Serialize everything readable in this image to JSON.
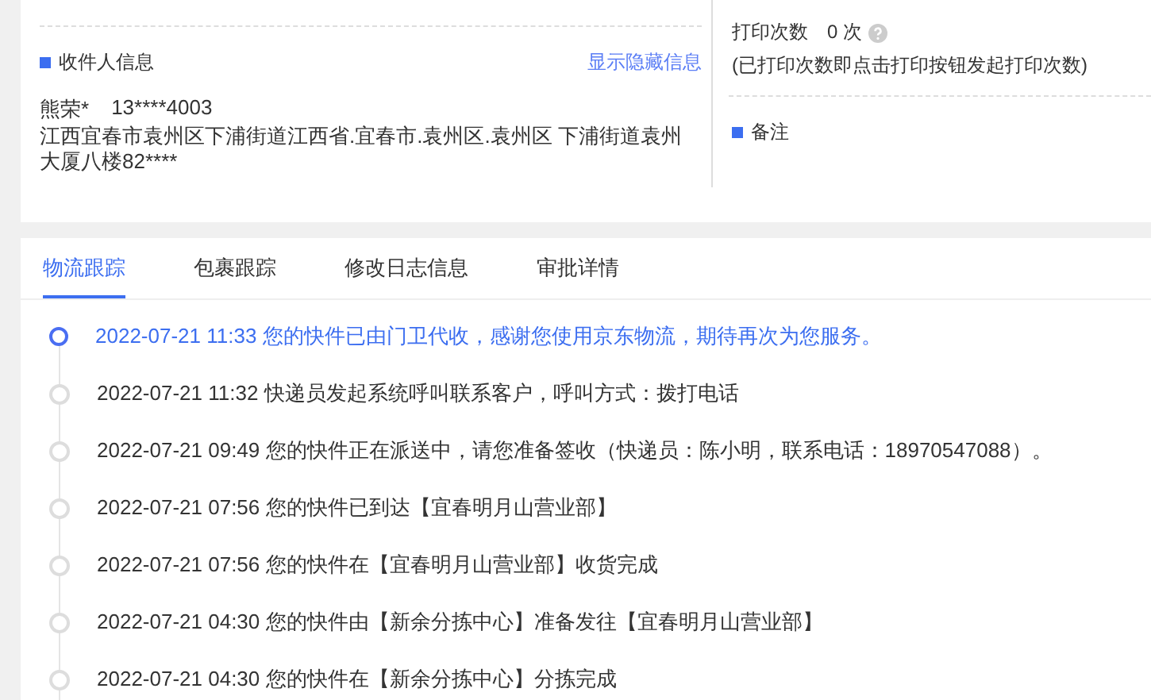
{
  "recipient": {
    "title": "收件人信息",
    "toggle_link": "显示隐藏信息",
    "name": "熊荣*",
    "phone": "13****4003",
    "address": "江西宜春市袁州区下浦街道江西省.宜春市.袁州区.袁州区 下浦街道袁州大厦八楼82****"
  },
  "print": {
    "label": "打印次数",
    "count": "0 次",
    "note": "(已打印次数即点击打印按钮发起打印次数)"
  },
  "remarks": {
    "title": "备注"
  },
  "tabs": [
    {
      "label": "物流跟踪",
      "selected": true
    },
    {
      "label": "包裹跟踪",
      "selected": false
    },
    {
      "label": "修改日志信息",
      "selected": false
    },
    {
      "label": "审批详情",
      "selected": false
    }
  ],
  "timeline": [
    {
      "time": "2022-07-21 11:33",
      "text": "您的快件已由门卫代收，感谢您使用京东物流，期待再次为您服务。",
      "current": true
    },
    {
      "time": "2022-07-21 11:32",
      "text": "快递员发起系统呼叫联系客户，呼叫方式：拨打电话",
      "current": false
    },
    {
      "time": "2022-07-21 09:49",
      "text": "您的快件正在派送中，请您准备签收（快递员：陈小明，联系电话：18970547088）。",
      "current": false
    },
    {
      "time": "2022-07-21 07:56",
      "text": "您的快件已到达【宜春明月山营业部】",
      "current": false
    },
    {
      "time": "2022-07-21 07:56",
      "text": "您的快件在【宜春明月山营业部】收货完成",
      "current": false
    },
    {
      "time": "2022-07-21 04:30",
      "text": "您的快件由【新余分拣中心】准备发往【宜春明月山营业部】",
      "current": false
    },
    {
      "time": "2022-07-21 04:30",
      "text": "您的快件在【新余分拣中心】分拣完成",
      "current": false
    }
  ]
}
